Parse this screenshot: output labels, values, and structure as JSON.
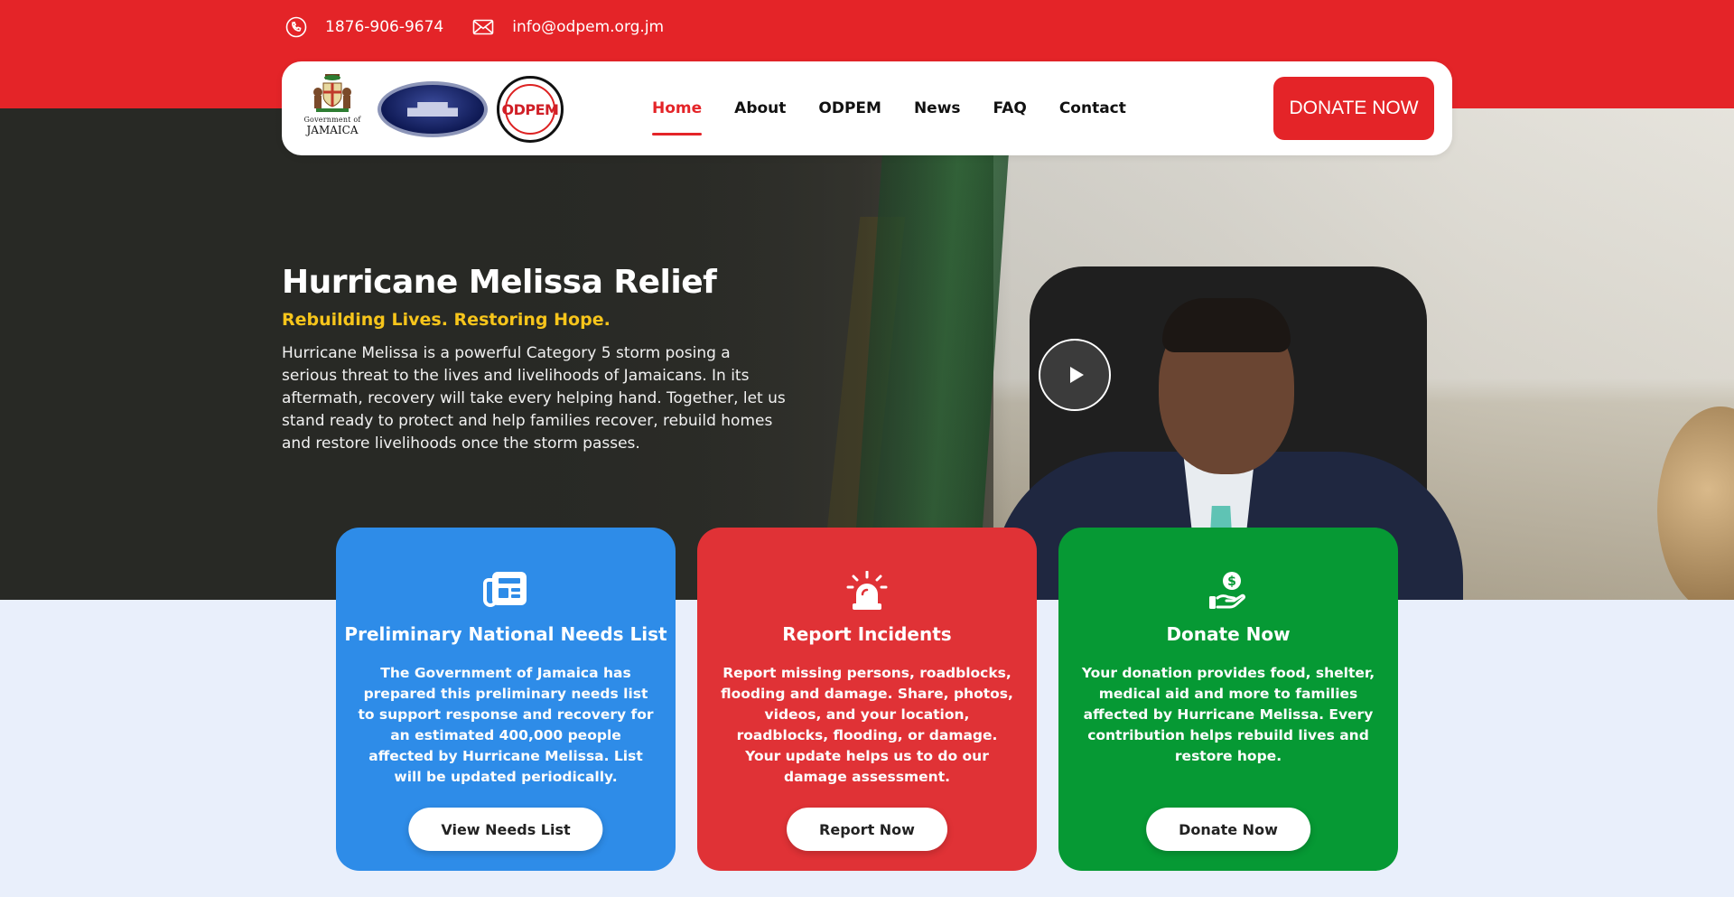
{
  "colors": {
    "brand_red": "#e42428",
    "accent_yellow": "#f7c51b",
    "card_blue": "#2e8ce8",
    "card_red": "#e03236",
    "card_green": "#069934"
  },
  "contact": {
    "phone_icon": "phone-icon",
    "phone": "1876-906-9674",
    "email_icon": "envelope-icon",
    "email": "info@odpem.org.jm"
  },
  "logos": {
    "gov_line1": "Government of",
    "gov_line2": "JAMAICA",
    "odpem": "ODPEM"
  },
  "nav": {
    "items": [
      {
        "label": "Home",
        "active": true
      },
      {
        "label": "About"
      },
      {
        "label": "ODPEM"
      },
      {
        "label": "News"
      },
      {
        "label": "FAQ"
      },
      {
        "label": "Contact"
      }
    ],
    "donate_label": "DONATE NOW"
  },
  "hero": {
    "title": "Hurricane Melissa Relief",
    "tagline": "Rebuilding Lives. Restoring Hope.",
    "body": "Hurricane Melissa is a powerful Category 5 storm posing a serious threat to the lives and livelihoods of Jamaicans. In its aftermath, recovery will take every helping hand. Together, let us stand ready to protect and help families recover, rebuild homes and restore livelihoods once the storm passes.",
    "video_icon": "play-icon"
  },
  "cards": [
    {
      "icon": "newspaper-icon",
      "title": "Preliminary National Needs List",
      "body": "The Government of Jamaica has prepared this preliminary needs list to support response and recovery for an estimated 400,000 people affected by Hurricane Melissa. List will be updated periodically.",
      "button": "View Needs List"
    },
    {
      "icon": "siren-icon",
      "title": "Report Incidents",
      "body": "Report missing persons, roadblocks, flooding and damage. Share, photos, videos, and your location, roadblocks, flooding, or damage. Your update helps us to do our damage assessment.",
      "button": "Report Now"
    },
    {
      "icon": "hand-dollar-icon",
      "title": "Donate Now",
      "body": "Your donation provides food, shelter, medical aid and more to families affected by Hurricane Melissa. Every contribution helps rebuild lives and restore hope.",
      "button": "Donate Now"
    }
  ]
}
